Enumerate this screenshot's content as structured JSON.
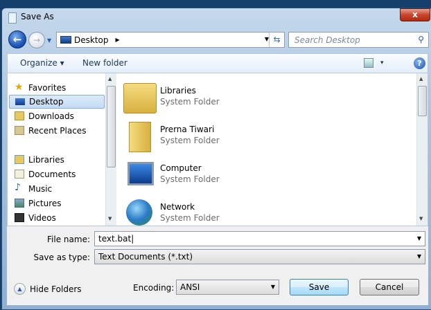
{
  "window": {
    "title": "Save As",
    "close_label": "x"
  },
  "nav": {
    "back": "←",
    "forward": "→",
    "address": "Desktop",
    "search_placeholder": "Search Desktop"
  },
  "toolbar": {
    "organize": "Organize ▾",
    "new_folder": "New folder",
    "view": "▾",
    "help": "?"
  },
  "sidebar": {
    "favorites": "Favorites",
    "items": [
      {
        "label": "Desktop"
      },
      {
        "label": "Downloads"
      },
      {
        "label": "Recent Places"
      }
    ],
    "libraries": "Libraries",
    "lib_items": [
      {
        "label": "Documents"
      },
      {
        "label": "Music"
      },
      {
        "label": "Pictures"
      },
      {
        "label": "Videos"
      }
    ]
  },
  "files": [
    {
      "name": "Libraries",
      "type": "System Folder"
    },
    {
      "name": "Prerna Tiwari",
      "type": "System Folder"
    },
    {
      "name": "Computer",
      "type": "System Folder"
    },
    {
      "name": "Network",
      "type": "System Folder"
    }
  ],
  "form": {
    "file_name_label": "File name:",
    "file_name": "text.bat",
    "type_label": "Save as type:",
    "type_value": "Text Documents (*.txt)",
    "encoding_label": "Encoding:",
    "encoding_value": "ANSI",
    "save": "Save",
    "cancel": "Cancel",
    "hide_folders": "Hide Folders"
  }
}
